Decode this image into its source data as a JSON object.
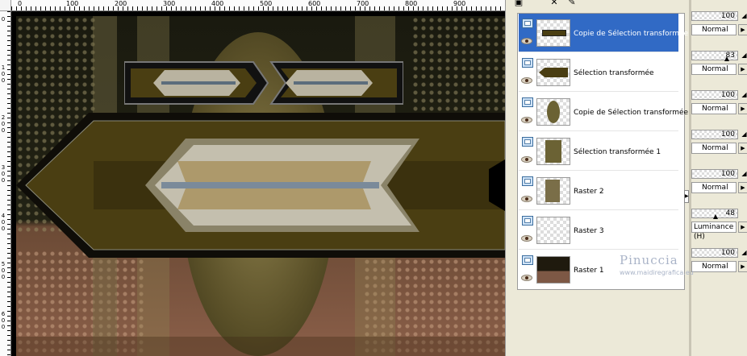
{
  "ruler": {
    "top_labels": [
      "0",
      "100",
      "200",
      "300",
      "400",
      "500",
      "600",
      "700",
      "800",
      "900"
    ],
    "left_labels": [
      "0",
      "1 0 0",
      "2 0 0",
      "3 0 0",
      "4 0 0",
      "5 0 0",
      "6 0 0"
    ]
  },
  "toolbar": {
    "new_layer_icon": "new-layer-icon",
    "delete_icon": "delete-layer-icon",
    "brush_icon": "edit-icon"
  },
  "layers": [
    {
      "name": "Copie de Sélection transformée",
      "opacity": "100",
      "blend": "Normal",
      "selected": true
    },
    {
      "name": "Sélection transformée",
      "opacity": "83",
      "blend": "Normal",
      "selected": false
    },
    {
      "name": "Copie de Sélection transformée",
      "opacity": "100",
      "blend": "Normal",
      "selected": false
    },
    {
      "name": "Sélection transformée 1",
      "opacity": "100",
      "blend": "Normal",
      "selected": false
    },
    {
      "name": "Raster 2",
      "opacity": "100",
      "blend": "Normal",
      "selected": false
    },
    {
      "name": "Raster 3",
      "opacity": "48",
      "blend": "Luminance (H)",
      "selected": false
    },
    {
      "name": "Raster 1",
      "opacity": "100",
      "blend": "Normal",
      "selected": false
    }
  ],
  "watermark": {
    "name": "Pinuccia",
    "url": "www.maidiregrafica.eu"
  },
  "colors": {
    "selection": "#316ac5",
    "panel_bg": "#ece9d8",
    "canvas_olive": "#4a3e12",
    "canvas_brown": "#8b5f49"
  }
}
